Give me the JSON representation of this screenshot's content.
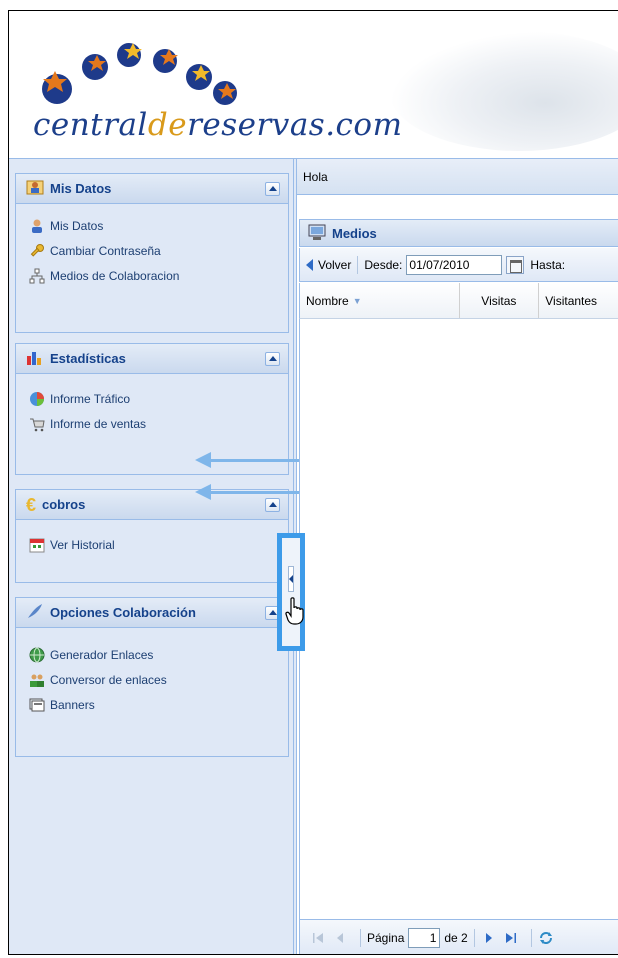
{
  "logo": {
    "text_a": "central",
    "text_b": "de",
    "text_c": "reservas.com"
  },
  "sidebar": {
    "panels": [
      {
        "title": "Mis Datos",
        "items": [
          {
            "label": "Mis Datos",
            "icon": "user-icon"
          },
          {
            "label": "Cambiar Contraseña",
            "icon": "key-icon"
          },
          {
            "label": "Medios de Colaboracion",
            "icon": "network-icon"
          }
        ]
      },
      {
        "title": "Estadísticas",
        "items": [
          {
            "label": "Informe Tráfico",
            "icon": "pie-chart-icon"
          },
          {
            "label": "Informe de ventas",
            "icon": "cart-icon"
          }
        ]
      },
      {
        "title": "cobros",
        "items": [
          {
            "label": "Ver Historial",
            "icon": "calendar-icon"
          }
        ]
      },
      {
        "title": "Opciones Colaboración",
        "items": [
          {
            "label": "Generador Enlaces",
            "icon": "globe-icon"
          },
          {
            "label": "Conversor de enlaces",
            "icon": "users-icon"
          },
          {
            "label": "Banners",
            "icon": "banner-icon"
          }
        ]
      }
    ]
  },
  "main": {
    "breadcrumb": "Hola",
    "panel_title": "Medios",
    "toolbar": {
      "back_label": "Volver",
      "from_label": "Desde:",
      "from_value": "01/07/2010",
      "to_label": "Hasta:"
    },
    "grid": {
      "columns": [
        "Nombre",
        "Visitas",
        "Visitantes"
      ]
    },
    "pager": {
      "page_label": "Página",
      "page_value": "1",
      "of_label": "de 2"
    }
  },
  "colors": {
    "accent": "#15428b",
    "highlight": "#3d9be9",
    "panel_bg": "#dfe8f6",
    "border": "#99bbe8"
  }
}
